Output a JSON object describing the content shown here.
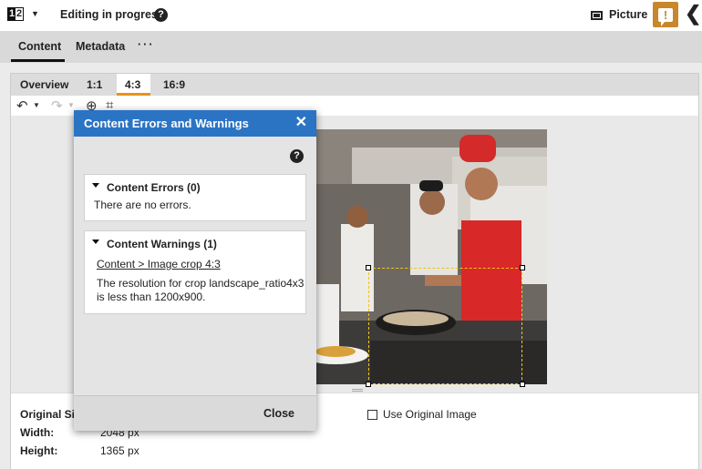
{
  "header": {
    "doc_icon_left": "1",
    "doc_icon_right": "2",
    "status": "Editing in progress",
    "help_glyph": "?",
    "content_type": "Picture",
    "warning_glyph": "!",
    "back_glyph": "❮",
    "icons": [
      "document-type-icon",
      "chevron-down-icon",
      "help-icon",
      "picture-icon",
      "warning-icon",
      "chevron-left-icon"
    ],
    "accent_color": "#c8872a"
  },
  "tabs": {
    "content": "Content",
    "metadata": "Metadata",
    "more": "···"
  },
  "crop_tabs": {
    "overview": "Overview",
    "r11": "1:1",
    "r43": "4:3",
    "r169": "16:9",
    "active": "4:3",
    "active_color": "#e8931c"
  },
  "toolbar": {
    "icons": [
      "undo-icon",
      "undo-dropdown-icon",
      "redo-icon",
      "redo-dropdown-icon",
      "focus-point-icon",
      "crop-icon"
    ]
  },
  "info": {
    "original_size_label": "Original Size",
    "width_label": "Width:",
    "width_value": "2048 px",
    "height_label": "Height:",
    "height_value": "1365 px",
    "use_original_label": "Use Original Image",
    "use_original_checked": false
  },
  "modal": {
    "title": "Content Errors and Warnings",
    "close_glyph": "✕",
    "help_glyph": "?",
    "header_color": "#2b74c4",
    "errors_title": "Content Errors (0)",
    "errors_text": "There are no errors.",
    "warnings_title": "Content Warnings (1)",
    "warning_link": "Content > Image crop 4:3",
    "warning_message": "The resolution for crop landscape_ratio4x3 is less than 1200x900.",
    "close_button": "Close"
  }
}
